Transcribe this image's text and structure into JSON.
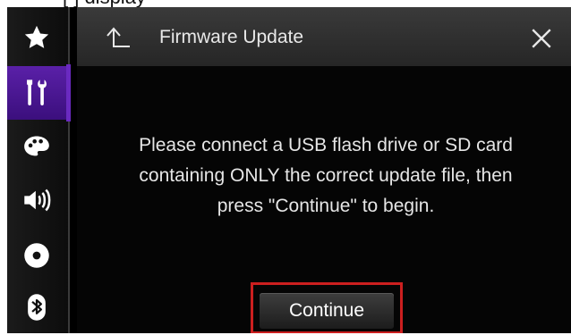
{
  "header": {
    "title": "Firmware Update"
  },
  "sidebar": {
    "items": [
      {
        "icon": "star-icon",
        "active": false
      },
      {
        "icon": "tools-icon",
        "active": true
      },
      {
        "icon": "palette-icon",
        "active": false
      },
      {
        "icon": "speaker-icon",
        "active": false
      },
      {
        "icon": "disc-icon",
        "active": false
      },
      {
        "icon": "bluetooth-icon",
        "active": false
      }
    ]
  },
  "main": {
    "message_lines": [
      "Please connect a USB flash drive or SD card",
      "containing ONLY the correct update file, then",
      "press \"Continue\" to begin."
    ],
    "continue_label": "Continue"
  },
  "colors": {
    "accent": "#5a20a8",
    "highlight_border": "#cc1f1f"
  }
}
